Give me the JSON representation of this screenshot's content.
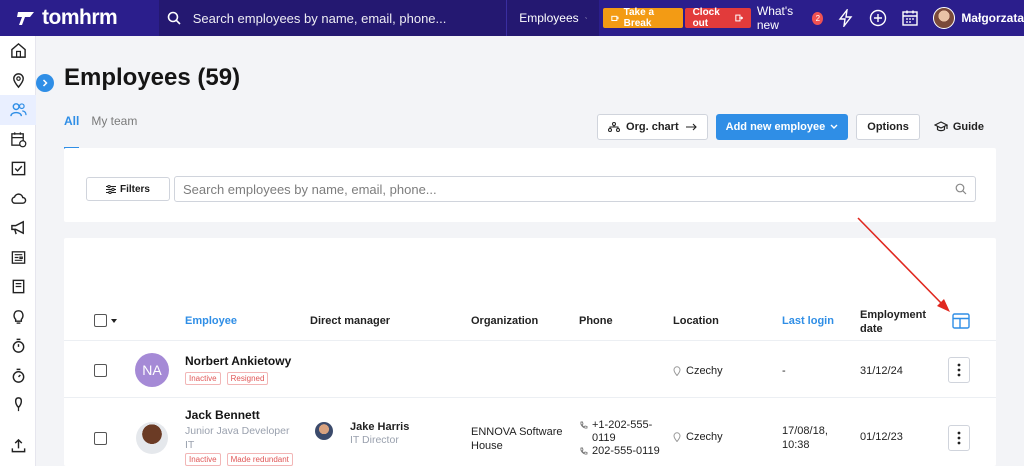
{
  "topbar": {
    "brand": "tomhrm",
    "search_placeholder": "Search employees by name, email, phone...",
    "scope": "Employees",
    "take_break": "Take a Break",
    "clock_out": "Clock out",
    "whats_new": "What's new",
    "whats_new_count": "2",
    "user_name": "Małgorzata"
  },
  "page": {
    "title": "Employees (59)",
    "tabs": [
      "All",
      "My team"
    ],
    "actions": {
      "org_chart": "Org. chart",
      "add_new": "Add new employee",
      "options": "Options",
      "guide": "Guide"
    }
  },
  "filters": {
    "button": "Filters",
    "search_placeholder": "Search employees by name, email, phone..."
  },
  "table": {
    "columns": [
      "Employee",
      "Direct manager",
      "Organization",
      "Phone",
      "Location",
      "Last login",
      "Employment",
      "date"
    ],
    "rows": [
      {
        "initials": "NA",
        "name": "Norbert Ankietowy",
        "tags": [
          "Inactive",
          "Resigned"
        ],
        "location": "Czechy",
        "last_login": "-",
        "employment_date": "31/12/24"
      },
      {
        "name": "Jack Bennett",
        "title_line1": "Junior Java Developer",
        "title_line2": "IT",
        "tags": [
          "Inactive",
          "Made redundant"
        ],
        "manager_name": "Jake Harris",
        "manager_title": "IT Director",
        "organization_line1": "ENNOVA Software",
        "organization_line2": "House",
        "phone1_line1": "+1-202-555-",
        "phone1_line2": "0119",
        "phone2": "202-555-0119",
        "location": "Czechy",
        "last_login_line1": "17/08/18,",
        "last_login_line2": "10:38",
        "employment_date": "01/12/23"
      }
    ]
  },
  "colors": {
    "topbar": "#2b1e8c",
    "accent": "#2f8ee6",
    "break": "#f39b14",
    "clock_out": "#e23b3b",
    "annotation_arrow": "#e0281f"
  }
}
